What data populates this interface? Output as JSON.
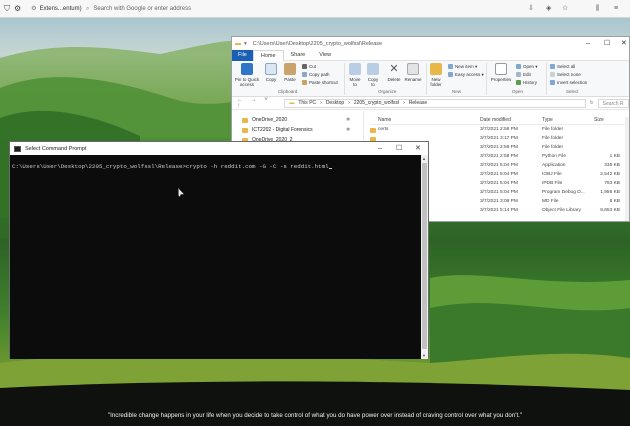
{
  "browser": {
    "tab_label": "Extens...entum)",
    "url_placeholder": "Search with Google or enter address",
    "icons": [
      "shield-icon",
      "settings-icon",
      "bookmark-icon",
      "library-icon",
      "menu-icon"
    ]
  },
  "explorer": {
    "title_path": "C:\\Users\\User\\Desktop\\2205_crypto_wolfssl\\Release",
    "menu": {
      "file": "File",
      "home": "Home",
      "share": "Share",
      "view": "View"
    },
    "ribbon": {
      "pin_quick_access": "Pin to Quick access",
      "copy": "Copy",
      "paste": "Paste",
      "cut": "Cut",
      "copy_path": "Copy path",
      "paste_shortcut": "Paste shortcut",
      "move_to": "Move to",
      "copy_to": "Copy to",
      "delete": "Delete",
      "rename": "Rename",
      "new_folder": "New folder",
      "new_item": "New item",
      "easy_access": "Easy access",
      "properties": "Properties",
      "open": "Open",
      "edit": "Edit",
      "history": "History",
      "select_all": "Select all",
      "select_none": "Select none",
      "invert_selection": "Invert selection",
      "group_clipboard": "Clipboard",
      "group_organize": "Organize",
      "group_new": "New",
      "group_open": "Open",
      "group_select": "Select"
    },
    "address": {
      "this_pc": "This PC",
      "desktop": "Desktop",
      "project": "2205_crypto_wolfssl",
      "release": "Release",
      "search_placeholder": "Search R"
    },
    "nav_items": [
      {
        "label": "OneDrive_2020"
      },
      {
        "label": "ICT2202 - Digital Forensics"
      },
      {
        "label": "OneDrive_2020_2"
      }
    ],
    "columns": {
      "name": "Name",
      "date": "Date modified",
      "type": "Type",
      "size": "Size"
    },
    "files": [
      {
        "name": "certs",
        "date": "3/7/2021 2:58 PM",
        "type": "File folder",
        "size": ""
      },
      {
        "name": "",
        "date": "3/7/2021 3:17 PM",
        "type": "File folder",
        "size": ""
      },
      {
        "name": "",
        "date": "3/7/2021 2:59 PM",
        "type": "File folder",
        "size": ""
      },
      {
        "name": "",
        "date": "3/7/2021 2:58 PM",
        "type": "Python File",
        "size": "1 KB"
      },
      {
        "name": "",
        "date": "3/7/2021 5:04 PM",
        "type": "Application",
        "size": "335 KB"
      },
      {
        "name": "",
        "date": "3/7/2021 5:04 PM",
        "type": "IOBJ File",
        "size": "2,542 KB"
      },
      {
        "name": "",
        "date": "3/7/2021 5:04 PM",
        "type": "IPDB File",
        "size": "763 KB"
      },
      {
        "name": "",
        "date": "3/7/2021 5:04 PM",
        "type": "Program Debug D...",
        "size": "1,956 KB"
      },
      {
        "name": "",
        "date": "3/7/2021 3:08 PM",
        "type": "MD File",
        "size": "6 KB"
      },
      {
        "name": "",
        "date": "3/7/2021 5:14 PM",
        "type": "Object File Library",
        "size": "8,653 KB"
      }
    ]
  },
  "cmd": {
    "title": "Select Command Prompt",
    "line": "C:\\Users\\User\\Desktop\\2205_crypto_wolfssl\\Release>crypto -h reddit.com -G -C -s reddit.html"
  },
  "quote": "\"Incredible change happens in your life when you decide to take control of what you do have power over instead of craving control over what you don't.\"",
  "colors": {
    "accent": "#1a5fb4",
    "folder": "#e8b74a",
    "console_bg": "#0c0c0c",
    "console_text": "#cccccc"
  }
}
